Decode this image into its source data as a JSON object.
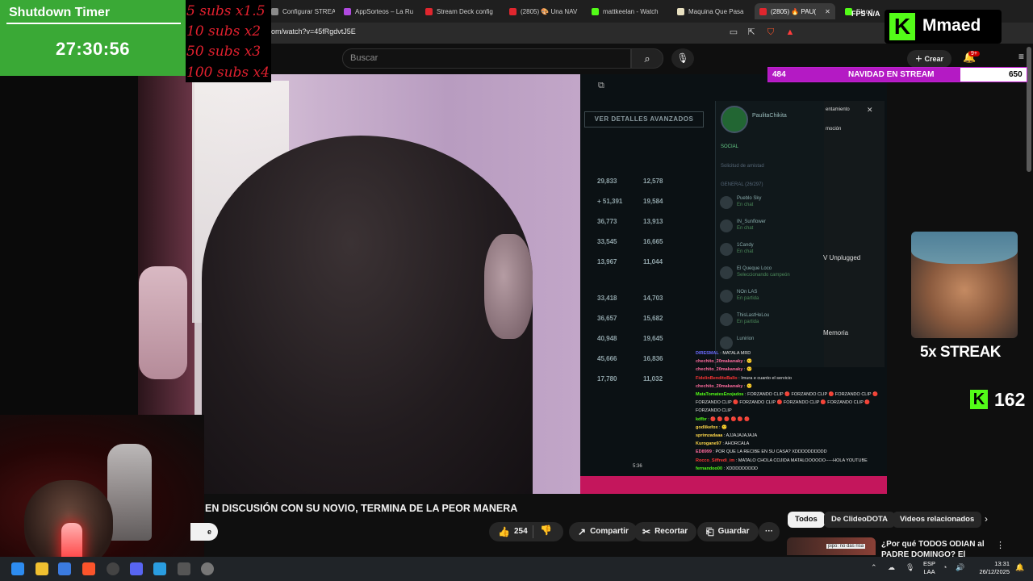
{
  "browser": {
    "tabs": [
      {
        "label": "Configurar STREAM",
        "color": "#8a8a8a"
      },
      {
        "label": "AppSorteos – La Ru",
        "color": "#b04ae0"
      },
      {
        "label": "Stream Deck config",
        "color": "#e0262e"
      },
      {
        "label": "(2805) 🎨 Una NAV",
        "color": "#e0262e"
      },
      {
        "label": "mattkeelan - Watch",
        "color": "#53fc18"
      },
      {
        "label": "Maquina Que Pasa",
        "color": "#e8e0c0"
      },
      {
        "label": "(2805) 🔥 PAU(",
        "color": "#e0262e",
        "active": true
      },
      {
        "label": "Elaoded",
        "color": "#53fc18"
      }
    ],
    "url": "om/watch?v=45fRgdvtJ5E"
  },
  "youtube": {
    "search_placeholder": "Buscar",
    "create_label": "Crear",
    "notif_count": "9+"
  },
  "overlay": {
    "timer_title": "Shutdown Timer",
    "timer_value": "27:30:56",
    "subs": [
      "5 subs x1.5",
      "10 subs x2",
      "50 subs x3",
      "100 subs x4"
    ],
    "fps": "FPS N/A",
    "kick_name": "Mmaed",
    "goal_current": "484",
    "goal_title": "NAVIDAD EN STREAM",
    "goal_target": "650",
    "goal_progress": 0.745,
    "streak_label": "5x STREAK",
    "kick_count": "162"
  },
  "game": {
    "advanced_button": "VER DETALLES AVANZADOS",
    "profile_name": "PaulitaChikita",
    "social_label": "SOCIAL",
    "social_request": "Solicitud de amistad",
    "general_header": "GENERAL (26/297)",
    "friends": [
      {
        "name": "Pueblo Sky",
        "status": "En chat"
      },
      {
        "name": "IN_Sunflower",
        "status": "En chat"
      },
      {
        "name": "1Candy",
        "status": "En chat"
      },
      {
        "name": "El Queque Loco",
        "status": "Seleccionando campeón"
      },
      {
        "name": "NOn LAS",
        "status": "En partida"
      },
      {
        "name": "ThisLastHeLou",
        "status": "En partida"
      },
      {
        "name": "Lunirion",
        "status": ""
      }
    ],
    "side_labels": [
      "entamiento",
      "moción",
      "V Unplugged",
      "Memoria"
    ],
    "time_display": "5:36",
    "stats": [
      [
        "29,833",
        "12,578"
      ],
      [
        "+ 51,391",
        "19,584"
      ],
      [
        "36,773",
        "13,913"
      ],
      [
        "33,545",
        "16,665"
      ],
      [
        "13,967",
        "11,044"
      ],
      [
        "33,418",
        "14,703"
      ],
      [
        "36,657",
        "15,682"
      ],
      [
        "40,948",
        "19,645"
      ],
      [
        "45,666",
        "16,836"
      ],
      [
        "17,780",
        "11,032"
      ]
    ]
  },
  "chat": [
    {
      "user": "DIRESMAL",
      "color": "#6b6bff",
      "text": "MATALA MRD"
    },
    {
      "user": "chechito_20makanaky",
      "color": "#ff6b9e",
      "text": "🙂"
    },
    {
      "user": "chechito_20makanaky",
      "color": "#ff6b9e",
      "text": "🙂"
    },
    {
      "user": "FidelinBenditoBallo",
      "color": "#ff3535",
      "text": "Imura e cuanto el servicio"
    },
    {
      "user": "chechito_20makanaky",
      "color": "#ff6b9e",
      "text": "🙂"
    },
    {
      "user": "MataTomatesEnojados",
      "color": "#53fc18",
      "text": "FORZANDO CLIP 🔴 FORZANDO CLIP 🔴 FORZANDO CLIP 🔴 FORZANDO CLIP 🔴 FORZANDO CLIP 🔴 FORZANDO CLIP 🔴 FORZANDO CLIP 🔴 FORZANDO CLIP"
    },
    {
      "user": "kdfbr",
      "color": "#53fc18",
      "text": "🔴 🔴 🔴 🔴 🔴 🔴"
    },
    {
      "user": "godlikefox",
      "color": "#ffd84a",
      "text": "🙂"
    },
    {
      "user": "sprimzadaaa",
      "color": "#ffd84a",
      "text": "AJJAJAJAJAJA"
    },
    {
      "user": "Kurogane97",
      "color": "#ffd84a",
      "text": "AHORCALA"
    },
    {
      "user": "ED8999",
      "color": "#ff6b9e",
      "text": "POR QUE LA RECIBE EN SU CASA? XDDDDDDDDDD"
    },
    {
      "user": "Rocco_Siffredi_im",
      "color": "#ff3535",
      "text": "MATALO CHOLA COJIDA MATALOOOOOO-----HOLA YOUTUBE"
    },
    {
      "user": "fernandoo00",
      "color": "#53fc18",
      "text": "XDDDDDDDDD"
    }
  ],
  "video": {
    "title": "EN DISCUSIÓN CON SU NOVIO, TERMINA DE LA PEOR MANERA",
    "subscribe_partial": "e",
    "likes": "254",
    "share_label": "Compartir",
    "clip_label": "Recortar",
    "save_label": "Guardar"
  },
  "related": {
    "chips": [
      "Todos",
      "De ClideoDOTA",
      "Videos relacionados"
    ],
    "item_title": "¿Por qué TODOS ODIAN al PADRE DOMINGO? El Streama...",
    "item_tag": "pipo: no das risa"
  },
  "taskbar": {
    "lang": "ESP",
    "layout": "LAA",
    "time": "13:31",
    "date": "26/12/2025"
  }
}
